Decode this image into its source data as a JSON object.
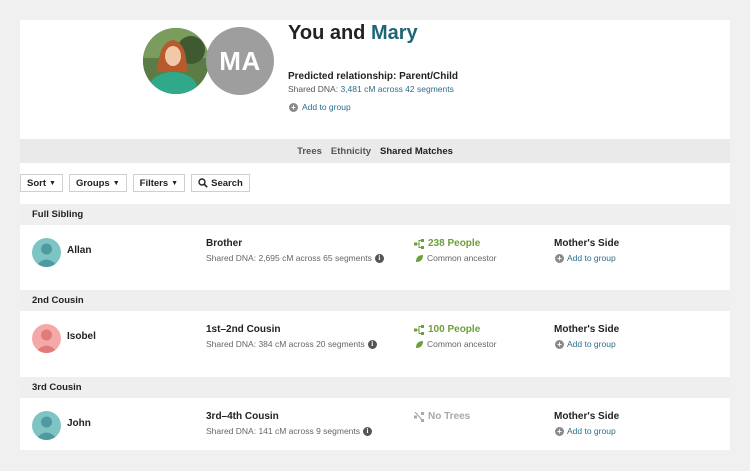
{
  "header": {
    "initials": "MA",
    "title_prefix": "You and ",
    "title_name": "Mary",
    "predicted": "Predicted relationship: Parent/Child",
    "shared_prefix": "Shared DNA: ",
    "shared_link": "3,481 cM across 42 segments",
    "add_to_group": "Add to group"
  },
  "tabs": [
    {
      "label": "Trees",
      "active": false
    },
    {
      "label": "Ethnicity",
      "active": false
    },
    {
      "label": "Shared Matches",
      "active": true
    }
  ],
  "toolbar": {
    "sort": "Sort",
    "groups": "Groups",
    "filters": "Filters",
    "search": "Search"
  },
  "sections": [
    {
      "heading": "Full Sibling",
      "match": {
        "name": "Allan",
        "avatar_color": "#4f9aa0",
        "relationship": "Brother",
        "dna": "Shared DNA: 2,695 cM across 65 segments",
        "trees": "238 People",
        "ancestor": "Common ancestor",
        "side": "Mother's Side",
        "add": "Add to group"
      }
    },
    {
      "heading": "2nd Cousin",
      "match": {
        "name": "Isobel",
        "avatar_color": "#e27a7a",
        "relationship": "1st–2nd Cousin",
        "dna": "Shared DNA: 384 cM across 20 segments",
        "trees": "100 People",
        "ancestor": "Common ancestor",
        "side": "Mother's Side",
        "add": "Add to group"
      }
    },
    {
      "heading": "3rd Cousin",
      "match": {
        "name": "John",
        "avatar_color": "#4f9aa0",
        "relationship": "3rd–4th Cousin",
        "dna": "Shared DNA: 141 cM across 9 segments",
        "trees": "No Trees",
        "side": "Mother's Side",
        "add": "Add to group"
      }
    }
  ],
  "colors": {
    "link": "#2d6e8a",
    "trees_green": "#6ca03a",
    "title_accent": "#1f6675"
  }
}
